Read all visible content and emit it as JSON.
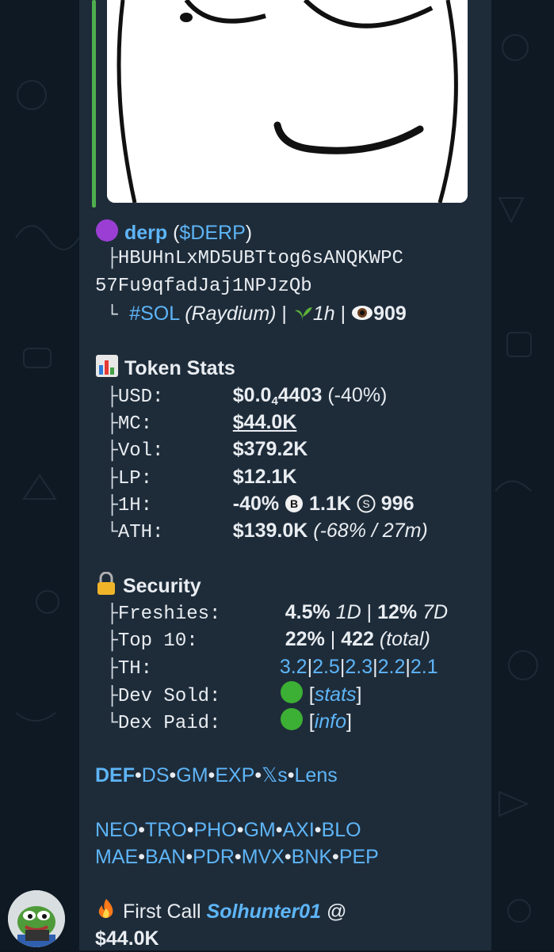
{
  "token": {
    "name": "derp",
    "ticker": "($DERP)",
    "address_line1": "HBUHnLxMD5UBTtog6sANQKWPC",
    "address_line2": "57Fu9qfadJaj1NPJzQb",
    "chain": "#SOL",
    "dex": "(Raydium)",
    "age": "1h",
    "views": "909"
  },
  "stats": {
    "title": "Token Stats",
    "usd_label": "USD:",
    "usd_prefix": "$0.0",
    "usd_sub": "4",
    "usd_rest": "4403",
    "usd_change": "(-40%)",
    "mc_label": "MC:",
    "mc_value": "$44.0K",
    "vol_label": "Vol:",
    "vol_value": "$379.2K",
    "lp_label": "LP:",
    "lp_value": "$12.1K",
    "h1_label": "1H:",
    "h1_change": "-40%",
    "h1_buys": "1.1K",
    "h1_sells": "996",
    "ath_label": "ATH:",
    "ath_value": "$139.0K",
    "ath_detail": "(-68% / 27m)"
  },
  "security": {
    "title": "Security",
    "freshies_label": "Freshies:",
    "freshies_1d": "4.5%",
    "freshies_1d_unit": "1D",
    "freshies_7d": "12%",
    "freshies_7d_unit": "7D",
    "top10_label": "Top 10:",
    "top10_pct": "22%",
    "top10_total": "422",
    "top10_total_label": "(total)",
    "th_label": "TH:",
    "th_values": [
      "3.2",
      "2.5",
      "2.3",
      "2.2",
      "2.1"
    ],
    "dev_sold_label": "Dev Sold:",
    "dev_sold_link": "stats",
    "dex_paid_label": "Dex Paid:",
    "dex_paid_link": "info"
  },
  "links_row1": [
    "DEF",
    "DS",
    "GM",
    "EXP",
    "𝕏s",
    "Lens"
  ],
  "links_row2": [
    "NEO",
    "TRO",
    "PHO",
    "GM",
    "AXI",
    "BLO"
  ],
  "links_row3": [
    "MAE",
    "BAN",
    "PDR",
    "MVX",
    "BNK",
    "PEP"
  ],
  "first_call": {
    "label": "First Call",
    "user": "Solhunter01",
    "at": "@",
    "value": "$44.0K"
  },
  "colors": {
    "link": "#5eb5f7",
    "bubble": "#1e2c3a",
    "accent_bar": "#4fae4e",
    "green_dot": "#3cb034"
  }
}
